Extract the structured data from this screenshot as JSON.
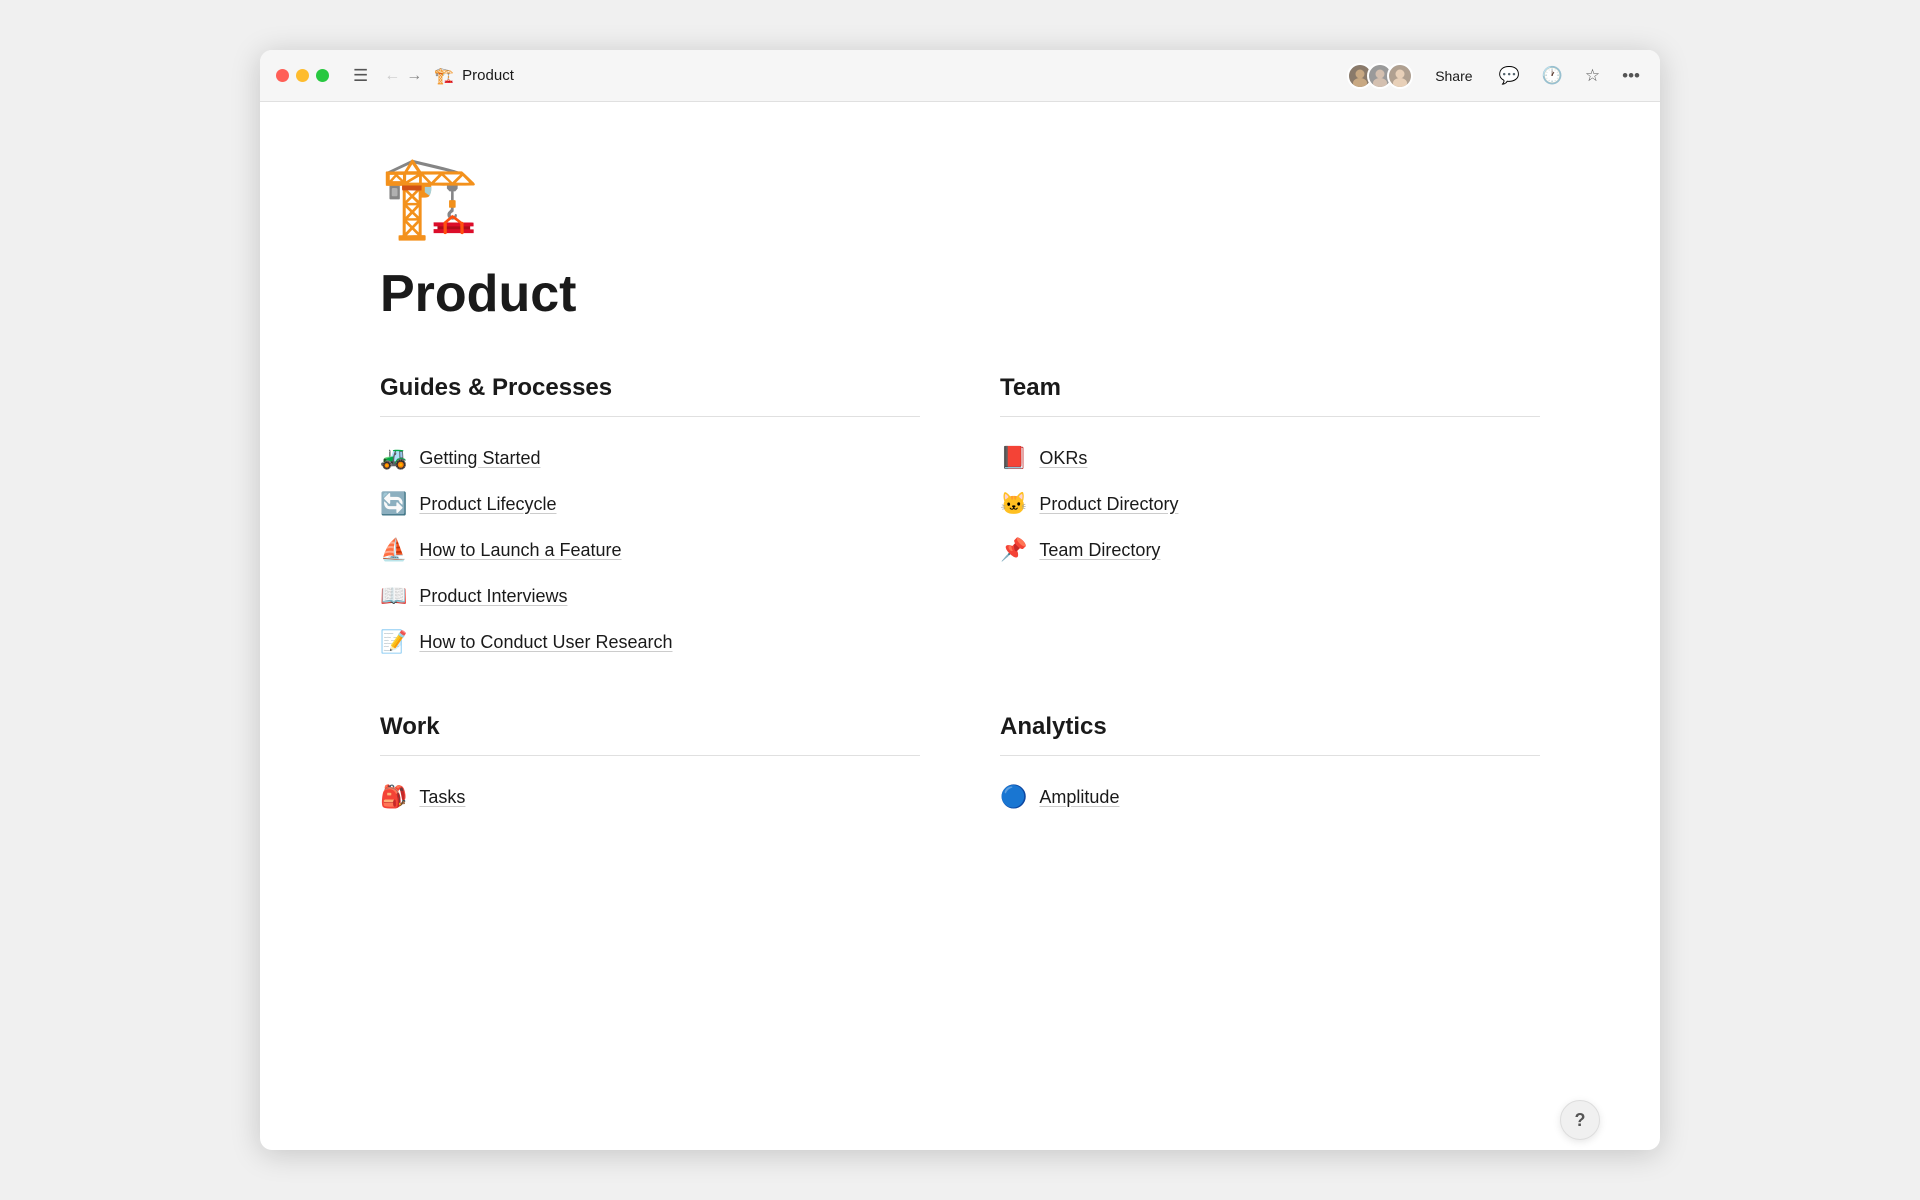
{
  "titlebar": {
    "title": "Product",
    "share_label": "Share"
  },
  "page": {
    "emoji": "🏗️",
    "title": "Product"
  },
  "sections": [
    {
      "id": "guides",
      "title": "Guides & Processes",
      "links": [
        {
          "emoji": "🚜",
          "text": "Getting Started"
        },
        {
          "emoji": "🔄",
          "text": "Product Lifecycle"
        },
        {
          "emoji": "⛵",
          "text": "How to Launch a Feature"
        },
        {
          "emoji": "📖",
          "text": "Product Interviews"
        },
        {
          "emoji": "📝",
          "text": "How to Conduct User Research"
        }
      ]
    },
    {
      "id": "team",
      "title": "Team",
      "links": [
        {
          "emoji": "📕",
          "text": "OKRs"
        },
        {
          "emoji": "🐱",
          "text": "Product Directory"
        },
        {
          "emoji": "📌",
          "text": "Team Directory"
        }
      ]
    },
    {
      "id": "work",
      "title": "Work",
      "links": [
        {
          "emoji": "🎒",
          "text": "Tasks"
        }
      ]
    },
    {
      "id": "analytics",
      "title": "Analytics",
      "links": [
        {
          "emoji": "🔵",
          "text": "Amplitude"
        }
      ]
    }
  ],
  "help_label": "?"
}
